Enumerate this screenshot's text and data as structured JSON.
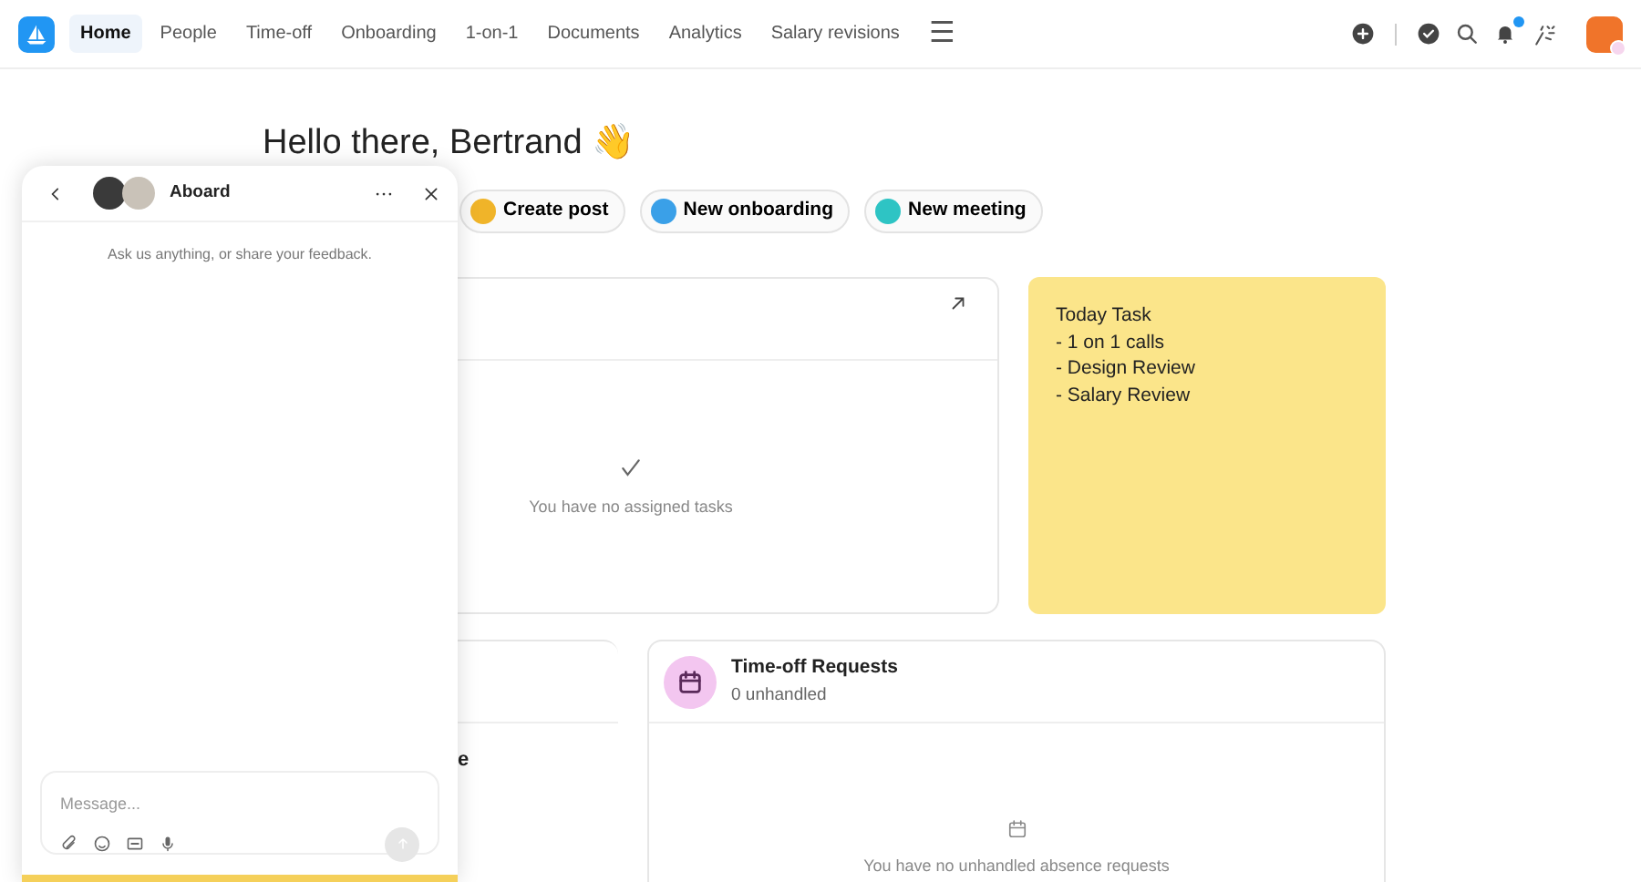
{
  "nav": {
    "items": [
      {
        "label": "Home",
        "selected": true
      },
      {
        "label": "People",
        "selected": false
      },
      {
        "label": "Time-off",
        "selected": false
      },
      {
        "label": "Onboarding",
        "selected": false
      },
      {
        "label": "1-on-1",
        "selected": false
      },
      {
        "label": "Documents",
        "selected": false
      },
      {
        "label": "Analytics",
        "selected": false
      },
      {
        "label": "Salary revisions",
        "selected": false
      }
    ],
    "more_icon": "☰",
    "notifications_unread": true
  },
  "greeting": {
    "text": "Hello there, Bertrand",
    "emoji": "👋"
  },
  "quick_actions": [
    {
      "label": "Create post",
      "color": "#f0b429"
    },
    {
      "label": "New onboarding",
      "color": "#3aa0e8"
    },
    {
      "label": "New meeting",
      "color": "#2ec4c4"
    }
  ],
  "tasks_card": {
    "empty_text": "You have no assigned tasks"
  },
  "sticky_note": {
    "lines": [
      "Today Task",
      "- 1 on 1 calls",
      "- Design Review",
      "- Salary Review"
    ]
  },
  "left_card": {
    "visible_text": "e"
  },
  "timeoff_card": {
    "title": "Time-off Requests",
    "subtitle": "0 unhandled",
    "empty_text": "You have no unhandled absence requests"
  },
  "chat": {
    "title": "Aboard",
    "intro": "Ask us anything, or share your feedback.",
    "message": {
      "placeholder": "Message..."
    }
  }
}
